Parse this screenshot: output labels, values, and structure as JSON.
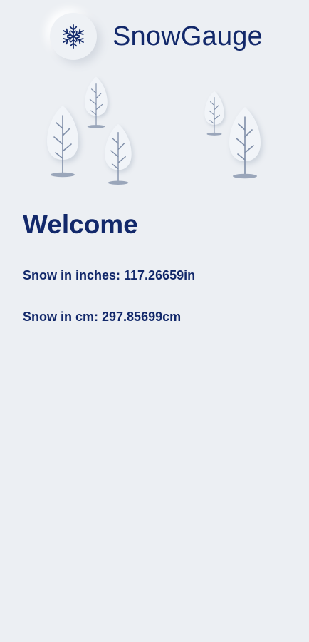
{
  "app": {
    "title": "SnowGauge",
    "logo_icon": "snowflake-icon"
  },
  "decoration": {
    "icon": "snowy-trees-illustration"
  },
  "main": {
    "heading": "Welcome",
    "snow_inches": {
      "label": "Snow in inches: ",
      "value": "117.26659in"
    },
    "snow_cm": {
      "label": "Snow in cm: ",
      "value": "297.85699cm"
    }
  },
  "colors": {
    "background": "#eceff3",
    "primary_text": "#12286a",
    "tree_trunk": "#7f8ea8"
  }
}
